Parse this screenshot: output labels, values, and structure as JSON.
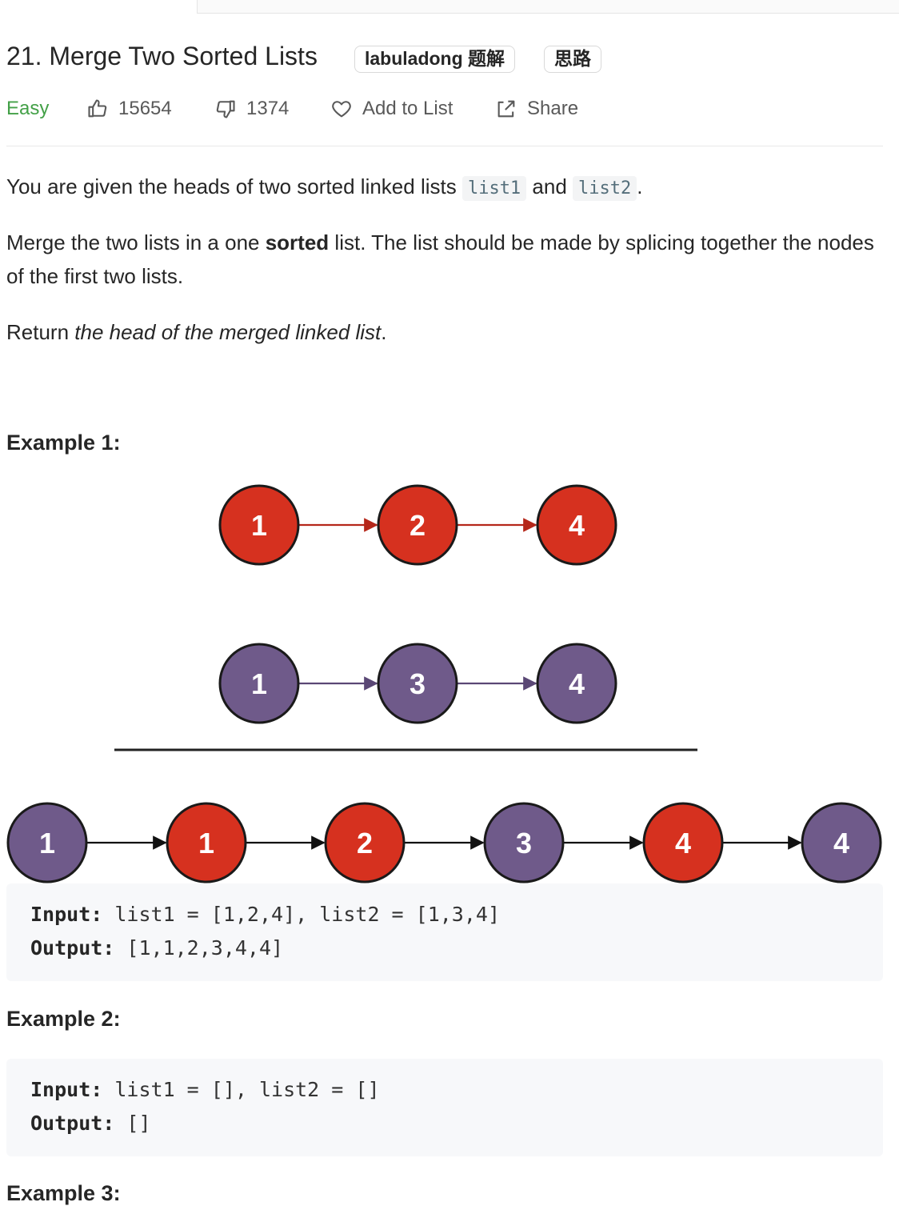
{
  "problem": {
    "title": "21. Merge Two Sorted Lists",
    "tags": [
      "labuladong 题解",
      "思路"
    ],
    "difficulty": "Easy",
    "likes": "15654",
    "dislikes": "1374",
    "add_to_list": "Add to List",
    "share": "Share"
  },
  "description": {
    "p1_before": "You are given the heads of two sorted linked lists ",
    "p1_code1": "list1",
    "p1_mid": " and ",
    "p1_code2": "list2",
    "p1_end": ".",
    "p2_before": "Merge the two lists in a one ",
    "p2_bold": "sorted",
    "p2_after": " list. The list should be made by splicing together the nodes of the first two lists.",
    "p3_before": "Return ",
    "p3_italic": "the head of the merged linked list",
    "p3_after": "."
  },
  "example1": {
    "heading": "Example 1:",
    "list1": [
      "1",
      "2",
      "4"
    ],
    "list2": [
      "1",
      "3",
      "4"
    ],
    "merged": [
      "1",
      "1",
      "2",
      "3",
      "4",
      "4"
    ],
    "input_label": "Input:",
    "input_value": " list1 = [1,2,4], list2 = [1,3,4]",
    "output_label": "Output:",
    "output_value": " [1,1,2,3,4,4]"
  },
  "example2": {
    "heading": "Example 2:",
    "input_label": "Input:",
    "input_value": " list1 = [], list2 = []",
    "output_label": "Output:",
    "output_value": " []"
  },
  "example3": {
    "heading": "Example 3:"
  },
  "colors": {
    "red_node": "#d6311f",
    "purple_node": "#6f5a8a",
    "easy": "#43a047"
  }
}
